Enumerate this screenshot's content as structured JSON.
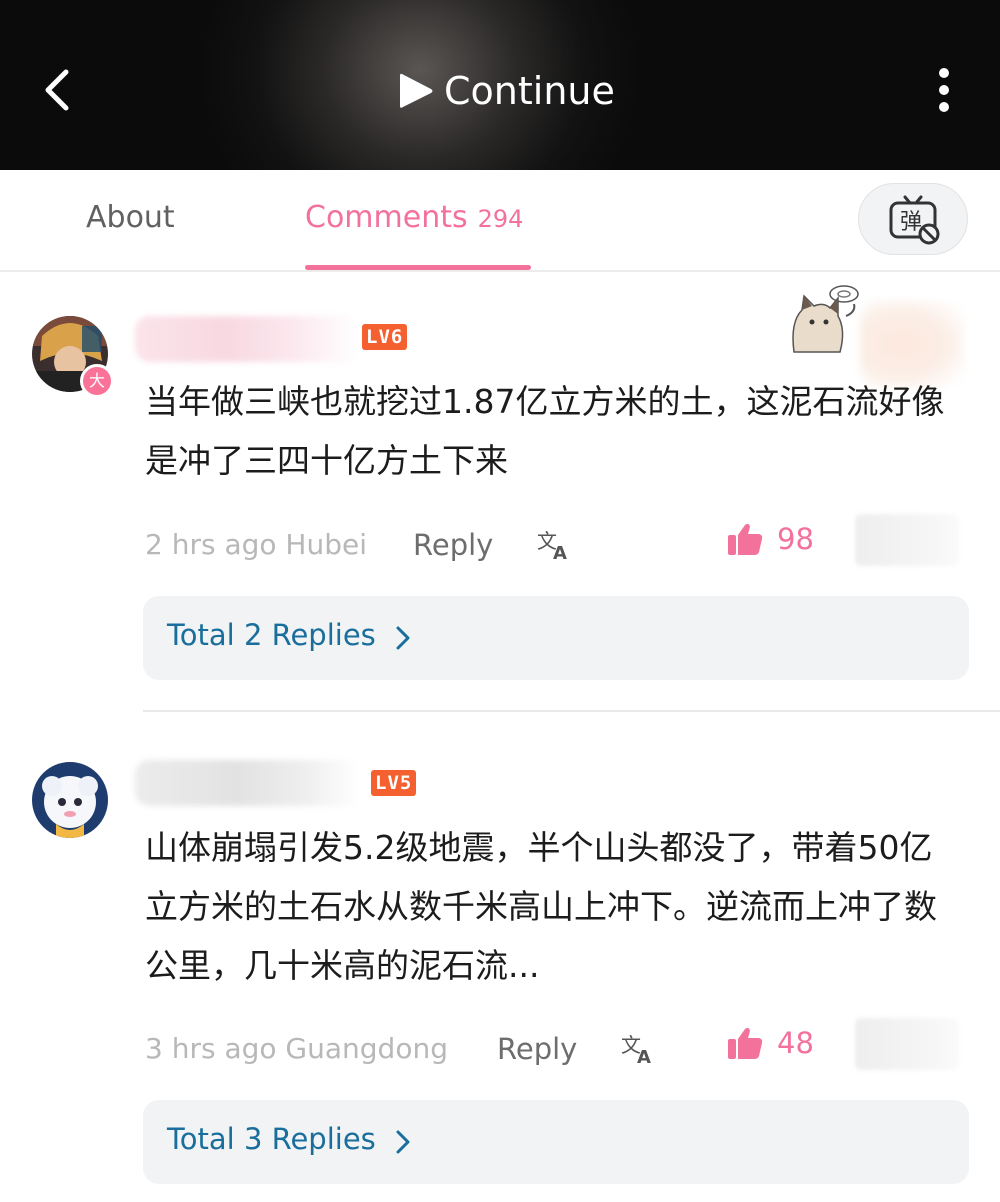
{
  "header": {
    "back_icon": "chevron-left-icon",
    "continue_label": "Continue",
    "more_icon": "vertical-dots-icon"
  },
  "tabs": {
    "about": "About",
    "comments": "Comments",
    "comments_count": "294",
    "active": "comments",
    "danmaku_icon": "danmaku-off-icon",
    "danmaku_char": "弹",
    "accent_color": "#f2729c"
  },
  "comments": [
    {
      "level": "LV6",
      "avatar_badge": "大",
      "text": "当年做三峡也就挖过1.87亿立方米的土，这泥石流好像是冲了三四十亿方土下来",
      "time_location": "2 hrs ago Hubei",
      "reply_label": "Reply",
      "translate_icon": "translate-icon",
      "like_icon": "thumbs-up-icon",
      "likes": "98",
      "replies_label": "Total 2 Replies"
    },
    {
      "level": "LV5",
      "text": "山体崩塌引发5.2级地震，半个山头都没了，带着50亿立方米的土石水从数千米高山上冲下。逆流而上冲了数公里，几十米高的泥石流...",
      "time_location": "3 hrs ago Guangdong",
      "reply_label": "Reply",
      "translate_icon": "translate-icon",
      "like_icon": "thumbs-up-icon",
      "likes": "48",
      "replies_label": "Total 3 Replies"
    }
  ]
}
